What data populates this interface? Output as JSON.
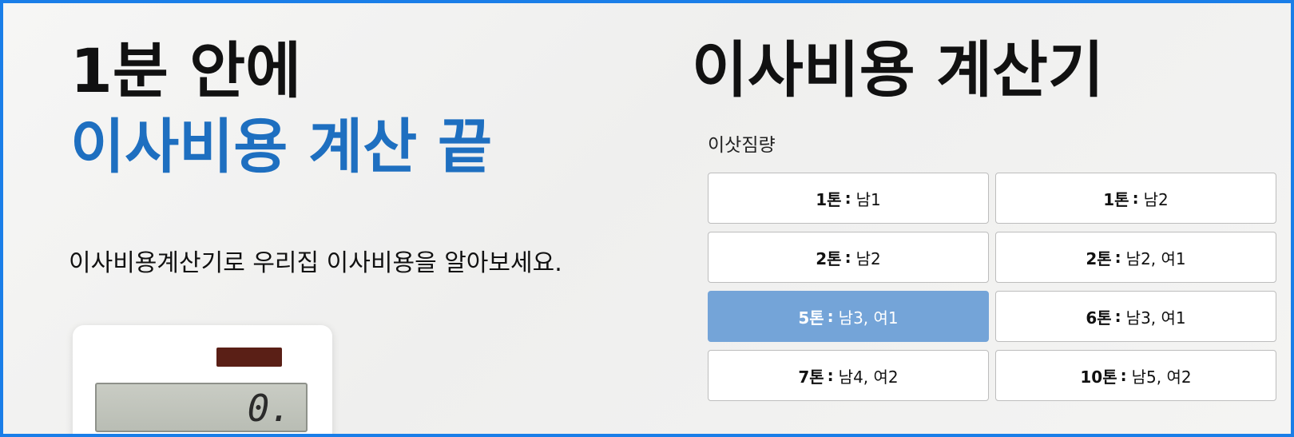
{
  "hero": {
    "line1": "1분 안에",
    "line2": "이사비용 계산 끝",
    "subtitle": "이사비용계산기로 우리집 이사비용을 알아보세요."
  },
  "calculator_title": "이사비용 계산기",
  "moving_load": {
    "label": "이삿짐량",
    "options": [
      {
        "ton": "1톤",
        "sep": ":",
        "people": "남1",
        "selected": false
      },
      {
        "ton": "1톤",
        "sep": ":",
        "people": "남2",
        "selected": false
      },
      {
        "ton": "2톤",
        "sep": ":",
        "people": "남2",
        "selected": false
      },
      {
        "ton": "2톤",
        "sep": ":",
        "people": "남2, 여1",
        "selected": false
      },
      {
        "ton": "5톤",
        "sep": ":",
        "people": "남3, 여1",
        "selected": true
      },
      {
        "ton": "6톤",
        "sep": ":",
        "people": "남3, 여1",
        "selected": false
      },
      {
        "ton": "7톤",
        "sep": ":",
        "people": "남4, 여2",
        "selected": false
      },
      {
        "ton": "10톤",
        "sep": ":",
        "people": "남5, 여2",
        "selected": false
      }
    ]
  },
  "calculator_display": "0.",
  "colors": {
    "frame_border": "#1a7ee8",
    "accent_blue": "#1e6fc0",
    "selected_option": "#74a4d8"
  }
}
